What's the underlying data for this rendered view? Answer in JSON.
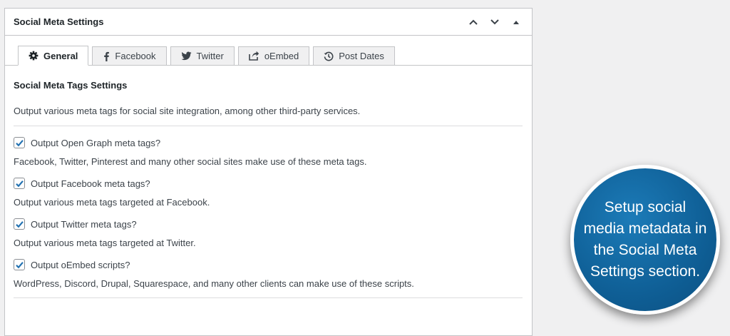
{
  "panel": {
    "title": "Social Meta Settings",
    "actions": [
      {
        "name": "move-up-icon"
      },
      {
        "name": "move-down-icon"
      },
      {
        "name": "collapse-toggle-icon"
      }
    ]
  },
  "tabs": [
    {
      "label": "General",
      "icon": "gear-icon",
      "active": true
    },
    {
      "label": "Facebook",
      "icon": "facebook-icon",
      "active": false
    },
    {
      "label": "Twitter",
      "icon": "twitter-icon",
      "active": false
    },
    {
      "label": "oEmbed",
      "icon": "share-icon",
      "active": false
    },
    {
      "label": "Post Dates",
      "icon": "history-icon",
      "active": false
    }
  ],
  "section": {
    "title": "Social Meta Tags Settings",
    "description": "Output various meta tags for social site integration, among other third-party services."
  },
  "options": [
    {
      "label": "Output Open Graph meta tags?",
      "checked": true,
      "description": "Facebook, Twitter, Pinterest and many other social sites make use of these meta tags."
    },
    {
      "label": "Output Facebook meta tags?",
      "checked": true,
      "description": "Output various meta tags targeted at Facebook."
    },
    {
      "label": "Output Twitter meta tags?",
      "checked": true,
      "description": "Output various meta tags targeted at Twitter."
    },
    {
      "label": "Output oEmbed scripts?",
      "checked": true,
      "description": "WordPress, Discord, Drupal, Squarespace, and many other clients can make use of these scripts."
    }
  ],
  "callout": {
    "text": "Setup social media metadata in the Social Meta Settings section."
  },
  "colors": {
    "checkmark": "#2271b1",
    "bubble": "#0f5f96"
  }
}
